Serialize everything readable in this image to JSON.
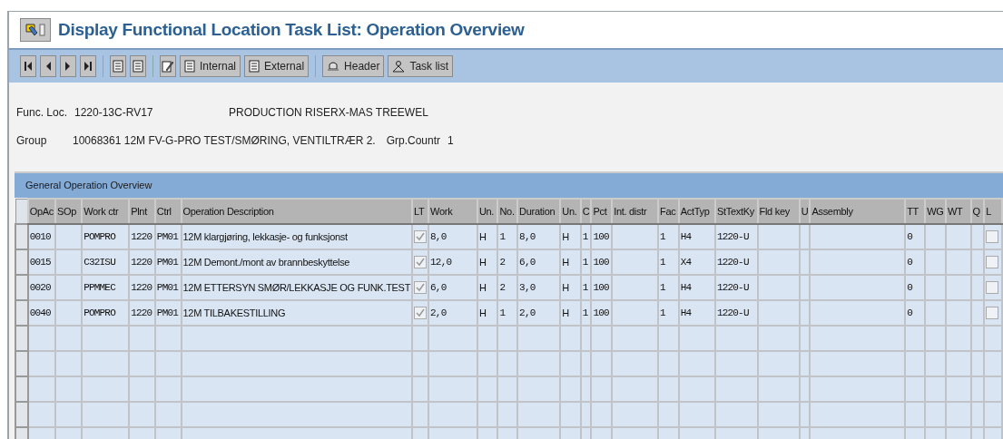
{
  "window": {
    "title": "Display Functional Location Task List: Operation Overview"
  },
  "toolbar": {
    "buttons": [
      {
        "kind": "first"
      },
      {
        "kind": "previous"
      },
      {
        "kind": "next"
      },
      {
        "kind": "last"
      },
      {
        "kind": "sep"
      },
      {
        "kind": "doc"
      },
      {
        "kind": "doc"
      },
      {
        "kind": "sep"
      },
      {
        "kind": "edit"
      },
      {
        "kind": "docbutton",
        "label": "Internal"
      },
      {
        "kind": "docbutton",
        "label": "External"
      },
      {
        "kind": "sep"
      },
      {
        "kind": "hatbutton",
        "label": "Header"
      },
      {
        "kind": "personbutton",
        "label": "Task list"
      }
    ]
  },
  "header": {
    "func_loc": {
      "label": "Func. Loc.",
      "value": "1220-13C-RV17",
      "description": "PRODUCTION RISERX-MAS TREEWEL"
    },
    "group": {
      "label": "Group",
      "value": "10068361 12M FV-G-PRO TEST/SMØRING, VENTILTRÆR 2.",
      "counter_label": "Grp.Countr",
      "counter": "1"
    }
  },
  "table": {
    "title": "General Operation Overview",
    "columns": [
      {
        "label": "OpAc",
        "kind": "code"
      },
      {
        "label": "SOp",
        "kind": "code"
      },
      {
        "label": "Work ctr",
        "kind": "code"
      },
      {
        "label": "Plnt",
        "kind": "code"
      },
      {
        "label": "Ctrl",
        "kind": "code"
      },
      {
        "label": "Operation Description",
        "kind": "text"
      },
      {
        "label": "LT",
        "kind": "check"
      },
      {
        "label": "Work",
        "kind": "code"
      },
      {
        "label": "Un.",
        "kind": "text"
      },
      {
        "label": "No.",
        "kind": "code"
      },
      {
        "label": "Duration",
        "kind": "code"
      },
      {
        "label": "Un.",
        "kind": "text"
      },
      {
        "label": "C",
        "kind": "code"
      },
      {
        "label": "Pct",
        "kind": "code"
      },
      {
        "label": "Int. distr",
        "kind": "code"
      },
      {
        "label": "Fac",
        "kind": "code"
      },
      {
        "label": "ActTyp",
        "kind": "code"
      },
      {
        "label": "StTextKy",
        "kind": "code"
      },
      {
        "label": "Fld key",
        "kind": "code"
      },
      {
        "label": "U",
        "kind": "code"
      },
      {
        "label": "Assembly",
        "kind": "code"
      },
      {
        "label": "TT",
        "kind": "code"
      },
      {
        "label": "WG",
        "kind": "code"
      },
      {
        "label": "WT",
        "kind": "code"
      },
      {
        "label": "Q",
        "kind": "code"
      },
      {
        "label": "L",
        "kind": "check"
      }
    ],
    "rows": [
      {
        "cells": [
          {
            "text": "0010"
          },
          {},
          {
            "text": "POMPRO"
          },
          {
            "text": "1220"
          },
          {
            "text": "PM01"
          },
          {
            "text": "12M klargjøring, lekkasje- og funksjonst"
          },
          {
            "checked": true
          },
          {
            "text": "8,0"
          },
          {
            "text": "H"
          },
          {
            "text": "1"
          },
          {
            "text": "8,0"
          },
          {
            "text": "H"
          },
          {
            "text": "1"
          },
          {
            "text": "100"
          },
          {},
          {
            "text": "1"
          },
          {
            "text": "H4"
          },
          {
            "text": "1220-U"
          },
          {},
          {},
          {},
          {
            "text": "0"
          },
          {},
          {},
          {},
          {
            "checked": false
          }
        ]
      },
      {
        "cells": [
          {
            "text": "0015"
          },
          {},
          {
            "text": "C32ISU"
          },
          {
            "text": "1220"
          },
          {
            "text": "PM01"
          },
          {
            "text": "12M Demont./mont av brannbeskyttelse"
          },
          {
            "checked": true
          },
          {
            "text": "12,0"
          },
          {
            "text": "H"
          },
          {
            "text": "2"
          },
          {
            "text": "6,0"
          },
          {
            "text": "H"
          },
          {
            "text": "1"
          },
          {
            "text": "100"
          },
          {},
          {
            "text": "1"
          },
          {
            "text": "X4"
          },
          {
            "text": "1220-U"
          },
          {},
          {},
          {},
          {
            "text": "0"
          },
          {},
          {},
          {},
          {
            "checked": false
          }
        ]
      },
      {
        "cells": [
          {
            "text": "0020"
          },
          {},
          {
            "text": "PPMMEC"
          },
          {
            "text": "1220"
          },
          {
            "text": "PM01"
          },
          {
            "text": "12M ETTERSYN SMØR/LEKKASJE OG FUNK.TEST"
          },
          {
            "checked": true
          },
          {
            "text": "6,0"
          },
          {
            "text": "H"
          },
          {
            "text": "2"
          },
          {
            "text": "3,0"
          },
          {
            "text": "H"
          },
          {
            "text": "1"
          },
          {
            "text": "100"
          },
          {},
          {
            "text": "1"
          },
          {
            "text": "H4"
          },
          {
            "text": "1220-U"
          },
          {},
          {},
          {},
          {
            "text": "0"
          },
          {},
          {},
          {},
          {
            "checked": false
          }
        ]
      },
      {
        "cells": [
          {
            "text": "0040"
          },
          {},
          {
            "text": "POMPRO"
          },
          {
            "text": "1220"
          },
          {
            "text": "PM01"
          },
          {
            "text": "12M TILBAKESTILLING"
          },
          {
            "checked": true
          },
          {
            "text": "2,0"
          },
          {
            "text": "H"
          },
          {
            "text": "1"
          },
          {
            "text": "2,0"
          },
          {
            "text": "H"
          },
          {
            "text": "1"
          },
          {
            "text": "100"
          },
          {},
          {
            "text": "1"
          },
          {
            "text": "H4"
          },
          {
            "text": "1220-U"
          },
          {},
          {},
          {},
          {
            "text": "0"
          },
          {},
          {},
          {},
          {
            "checked": false
          }
        ]
      }
    ]
  }
}
